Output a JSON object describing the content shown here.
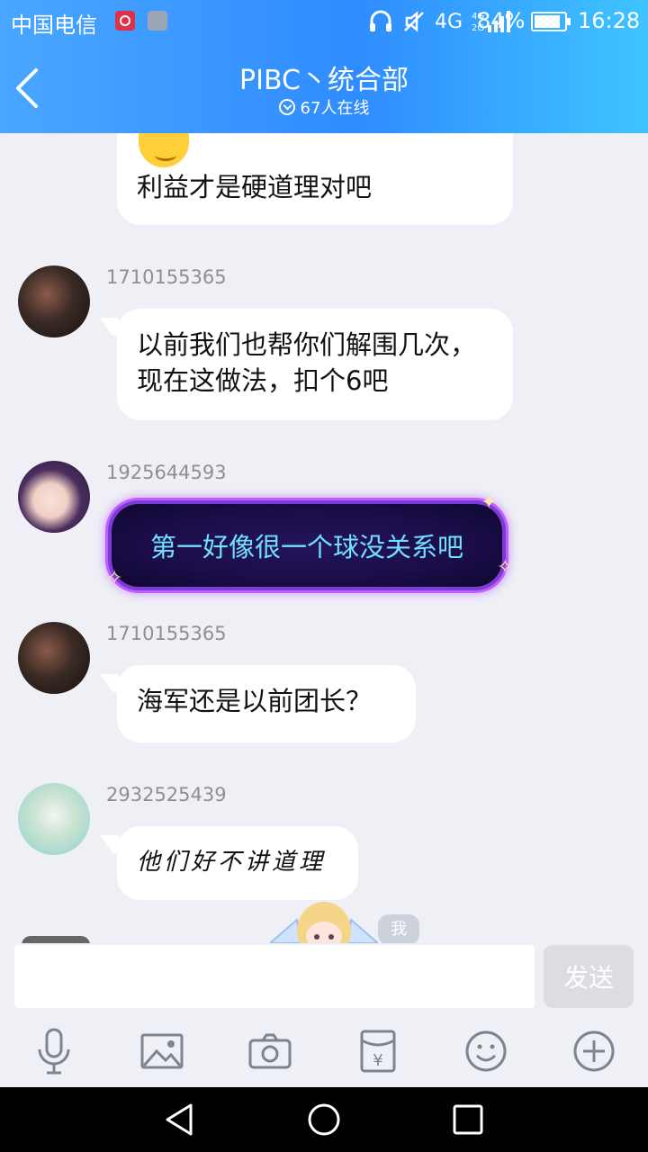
{
  "status_bar": {
    "carrier": "中国电信",
    "network": "4G",
    "network_small": "4G 2G",
    "battery": "84%",
    "time": "16:28"
  },
  "header": {
    "title": "PIBC丶统合部",
    "online": "67人在线"
  },
  "messages": [
    {
      "sender": "",
      "text": "利益才是硬道理对吧"
    },
    {
      "sender": "1710155365",
      "text": "以前我们也帮你们解围几次，现在这做法，扣个6吧"
    },
    {
      "sender": "1925644593",
      "text": "第一好像很一个球没关系吧"
    },
    {
      "sender": "1710155365",
      "text": "海军还是以前团长？"
    },
    {
      "sender": "2932525439",
      "text": "他们好不讲道理"
    }
  ],
  "me_badge": "我",
  "input": {
    "placeholder": "",
    "send_label": "发送"
  },
  "toolbar": [
    "mic-icon",
    "image-icon",
    "camera-icon",
    "red-packet-icon",
    "emoji-icon",
    "plus-icon"
  ],
  "colors": {
    "header_start": "#4aa6ff",
    "header_end": "#3fc4ff",
    "background": "#eff0f5",
    "fancy_text": "#6fe0ff"
  }
}
